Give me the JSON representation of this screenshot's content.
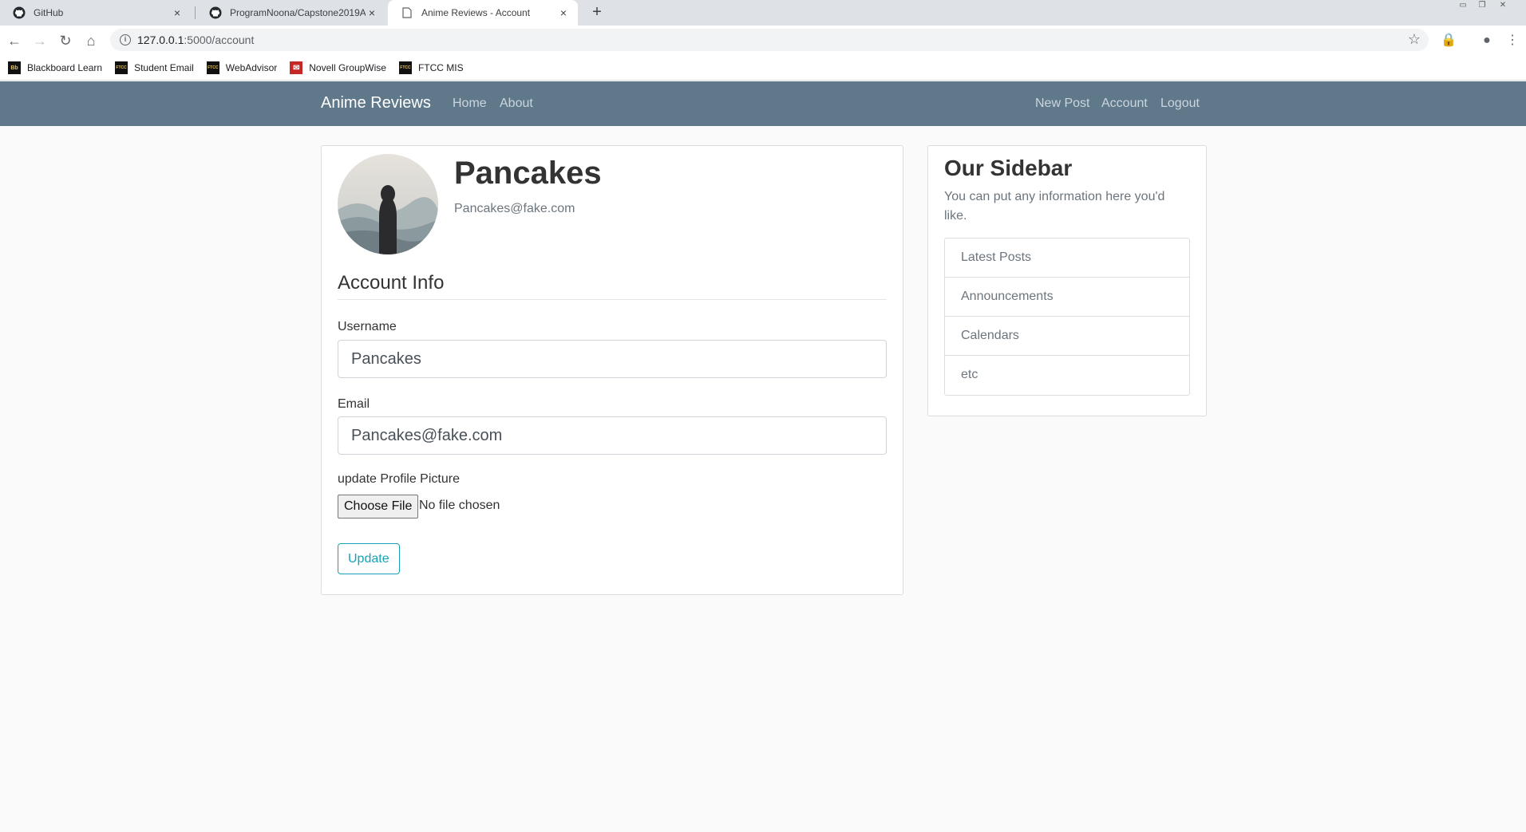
{
  "browser": {
    "tabs": [
      {
        "title": "GitHub",
        "icon": "github-icon"
      },
      {
        "title": "ProgramNoona/Capstone2019A",
        "icon": "github-icon"
      },
      {
        "title": "Anime Reviews - Account",
        "icon": "page-icon",
        "active": true
      }
    ],
    "new_tab_glyph": "+",
    "close_glyph": "×",
    "url_host": "127.0.0.1",
    "url_path": ":5000/account",
    "bookmarks": [
      {
        "label": "Blackboard Learn",
        "icon_text": "Bb"
      },
      {
        "label": "Student Email",
        "icon_text": "FTCC"
      },
      {
        "label": "WebAdvisor",
        "icon_text": "FTCC"
      },
      {
        "label": "Novell GroupWise",
        "icon_text": "✉"
      },
      {
        "label": "FTCC MIS",
        "icon_text": "FTCC"
      }
    ]
  },
  "navbar": {
    "brand": "Anime Reviews",
    "left_links": [
      "Home",
      "About"
    ],
    "right_links": [
      "New Post",
      "Account",
      "Logout"
    ],
    "background": "#5f788a"
  },
  "profile": {
    "username": "Pancakes",
    "email": "Pancakes@fake.com"
  },
  "form": {
    "legend": "Account Info",
    "username_label": "Username",
    "username_value": "Pancakes",
    "email_label": "Email",
    "email_value": "Pancakes@fake.com",
    "picture_label": "update Profile Picture",
    "choose_file_label": "Choose File",
    "file_status": "No file chosen",
    "submit_label": "Update",
    "accent": "#17a2b8"
  },
  "sidebar": {
    "title": "Our Sidebar",
    "text": "You can put any information here you'd like.",
    "items": [
      "Latest Posts",
      "Announcements",
      "Calendars",
      "etc"
    ]
  }
}
